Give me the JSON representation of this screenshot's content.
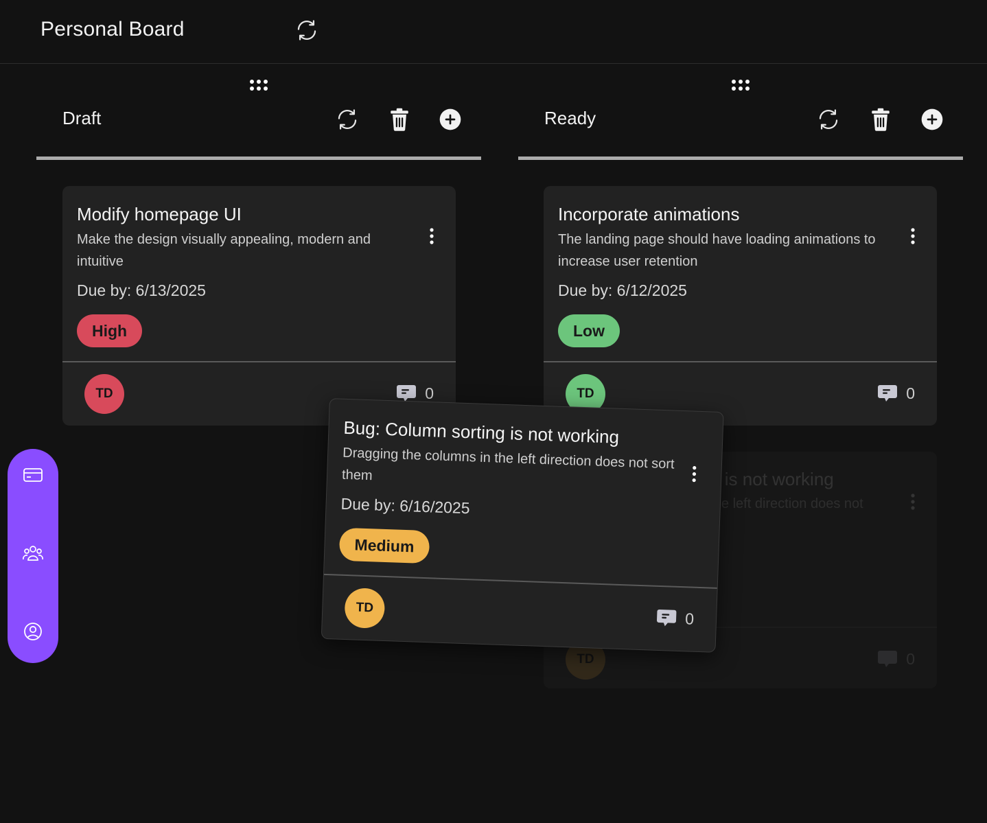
{
  "board": {
    "title": "Personal Board"
  },
  "columns": [
    {
      "title": "Draft",
      "cards": [
        {
          "title": "Modify homepage UI",
          "description": "Make the design visually appealing, modern and intuitive",
          "due": "Due by: 6/13/2025",
          "priority": "High",
          "priority_color": "#d84a5b",
          "assignee_initials": "TD",
          "assignee_color": "#d84a5b",
          "comment_count": "0"
        }
      ]
    },
    {
      "title": "Ready",
      "cards": [
        {
          "title": "Incorporate animations",
          "description": "The landing page should have loading animations to increase user retention",
          "due": "Due by: 6/12/2025",
          "priority": "Low",
          "priority_color": "#6cc57c",
          "assignee_initials": "TD",
          "assignee_color": "#6cc57c",
          "comment_count": "0"
        }
      ],
      "drop_placeholder": {
        "title": "Bug: Column sorting is not working",
        "description": "Dragging the columns in the left direction does not sort them",
        "assignee_initials": "TD",
        "comment_count": "0"
      }
    }
  ],
  "dragging_card": {
    "title": "Bug: Column sorting is not working",
    "description": "Dragging the columns in the left direction does not sort them",
    "due": "Due by: 6/16/2025",
    "priority": "Medium",
    "priority_color": "#f0b44c",
    "assignee_initials": "TD",
    "assignee_color": "#f0b44c",
    "comment_count": "0"
  },
  "sidenav": {
    "items": [
      {
        "icon": "card-icon"
      },
      {
        "icon": "team-icon"
      },
      {
        "icon": "profile-icon"
      }
    ],
    "color": "#8a4dff"
  },
  "colors": {
    "background": "#121212",
    "card": "#222222"
  }
}
